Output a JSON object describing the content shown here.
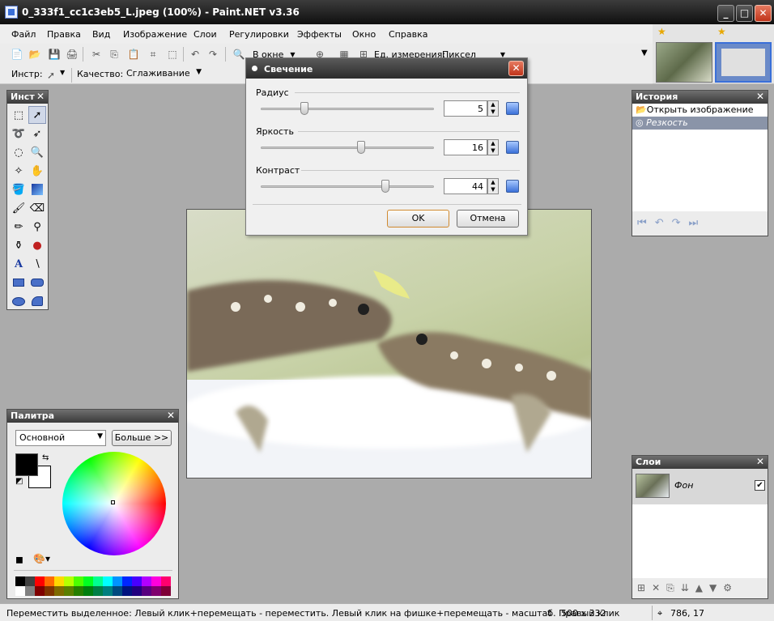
{
  "window": {
    "title": "0_333f1_cc1c3eb5_L.jpeg (100%) - Paint.NET v3.36",
    "minimize": "_",
    "maximize": "□",
    "close": "✕"
  },
  "menu": [
    "Файл",
    "Правка",
    "Вид",
    "Изображение",
    "Слои",
    "Регулировки",
    "Эффекты",
    "Окно",
    "Справка"
  ],
  "toolbar": {
    "zoom_value": "В окне",
    "units_label": "Ед. измерения:",
    "units_value": "Пиксел"
  },
  "toolbar2": {
    "tool_label": "Инстр:",
    "quality_label": "Качество:",
    "quality_value": "Сглаживание"
  },
  "tools_panel": {
    "title": "Инст",
    "close": "✕",
    "tools": [
      "rect-select-icon",
      "move-selection-icon",
      "lasso-icon",
      "move-selected-icon",
      "ellipse-select-icon",
      "zoom-icon",
      "magic-wand-icon",
      "pan-icon",
      "paint-bucket-icon",
      "gradient-icon",
      "paintbrush-icon",
      "eraser-icon",
      "pencil-icon",
      "color-picker-icon",
      "clone-stamp-icon",
      "recolor-icon",
      "text-icon",
      "line-icon",
      "rectangle-icon",
      "rounded-rect-icon",
      "ellipse-icon",
      "freeform-shape-icon"
    ]
  },
  "dialog": {
    "title": "Свечение",
    "close": "✕",
    "sliders": [
      {
        "label": "Радиус",
        "value": "5",
        "level": 0.25
      },
      {
        "label": "Яркость",
        "value": "16",
        "level": 0.58
      },
      {
        "label": "Контраст",
        "value": "44",
        "level": 0.72
      }
    ],
    "ok": "OK",
    "cancel": "Отмена"
  },
  "history": {
    "title": "История",
    "close": "✕",
    "items": [
      "Открыть изображение",
      "Резкость"
    ]
  },
  "layers": {
    "title": "Слои",
    "close": "✕",
    "items": [
      {
        "name": "Фон",
        "visible": true
      }
    ]
  },
  "palette": {
    "title": "Палитра",
    "close": "✕",
    "mode": "Основной",
    "more_button": "Больше >>",
    "primary_color": "#000000",
    "secondary_color": "#ffffff",
    "swatches_top": [
      "#000000",
      "#404040",
      "#ff0000",
      "#ff6a00",
      "#ffd800",
      "#b6ff00",
      "#4cff00",
      "#00ff21",
      "#00ff90",
      "#00ffff",
      "#0094ff",
      "#0026ff",
      "#4800ff",
      "#b200ff",
      "#ff00dc",
      "#ff006e"
    ],
    "swatches_bottom": [
      "#ffffff",
      "#808080",
      "#7f0000",
      "#7f3300",
      "#7f6a00",
      "#5b7f00",
      "#267f00",
      "#007f0e",
      "#007f46",
      "#007f7f",
      "#004a7f",
      "#00137f",
      "#21007f",
      "#57007f",
      "#7f006e",
      "#7f0037"
    ]
  },
  "status": {
    "hint": "Переместить выделенное: Левый клик+перемещать - переместить. Левый клик на фишке+перемещать - масштаб. Правый клик",
    "size": "500 x 332",
    "coords": "786, 17"
  }
}
